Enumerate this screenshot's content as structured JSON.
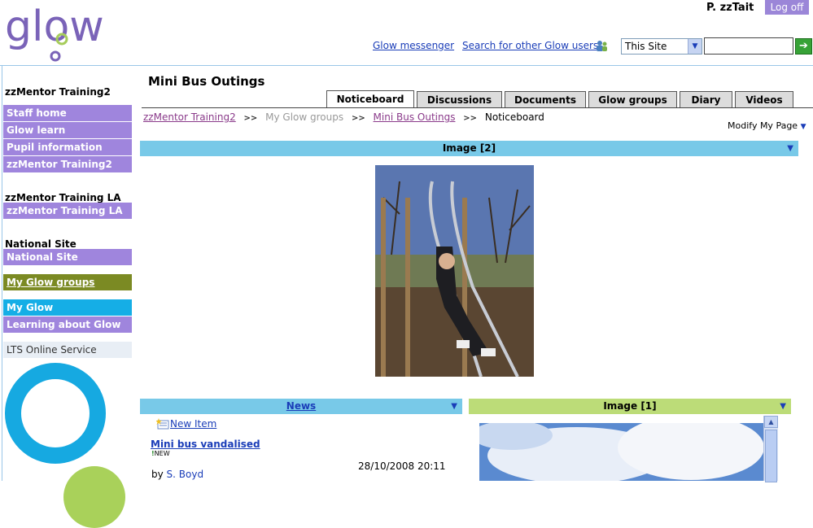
{
  "header": {
    "logo_text": "glow",
    "user_name": "P. zzTait",
    "logoff_label": "Log off",
    "messenger_link": "Glow messenger",
    "search_users_link": "Search for other Glow users",
    "search_scope": "This Site",
    "search_value": "",
    "accent_color": "#9b86d8"
  },
  "sidebar": {
    "groups": [
      {
        "heading": "zzMentor Training2",
        "items": [
          "Staff home",
          "Glow learn",
          "Pupil information",
          "zzMentor Training2"
        ]
      },
      {
        "heading": "zzMentor Training LA",
        "items": [
          "zzMentor Training LA"
        ]
      },
      {
        "heading": "National Site",
        "items": [
          "National Site"
        ]
      }
    ],
    "glow_groups": "My Glow groups",
    "my_glow": "My Glow",
    "learning": "Learning about Glow",
    "lts": "LTS Online Service"
  },
  "main": {
    "title": "Mini Bus Outings",
    "tabs": [
      "Noticeboard",
      "Discussions",
      "Documents",
      "Glow groups",
      "Diary",
      "Videos"
    ],
    "active_tab": "Noticeboard",
    "breadcrumb": [
      "zzMentor Training2",
      "My Glow groups",
      "Mini Bus Outings",
      "Noticeboard"
    ],
    "modify_page": "Modify My Page",
    "image_part_1": "Image [2]",
    "news_part": {
      "title": "News",
      "new_item": "New Item",
      "item_title": "Mini bus vandalised",
      "new_badge": "NEW",
      "date": "28/10/2008 20:11",
      "by_label": "by",
      "author": "S. Boyd"
    },
    "image_part_2": "Image [1]"
  }
}
